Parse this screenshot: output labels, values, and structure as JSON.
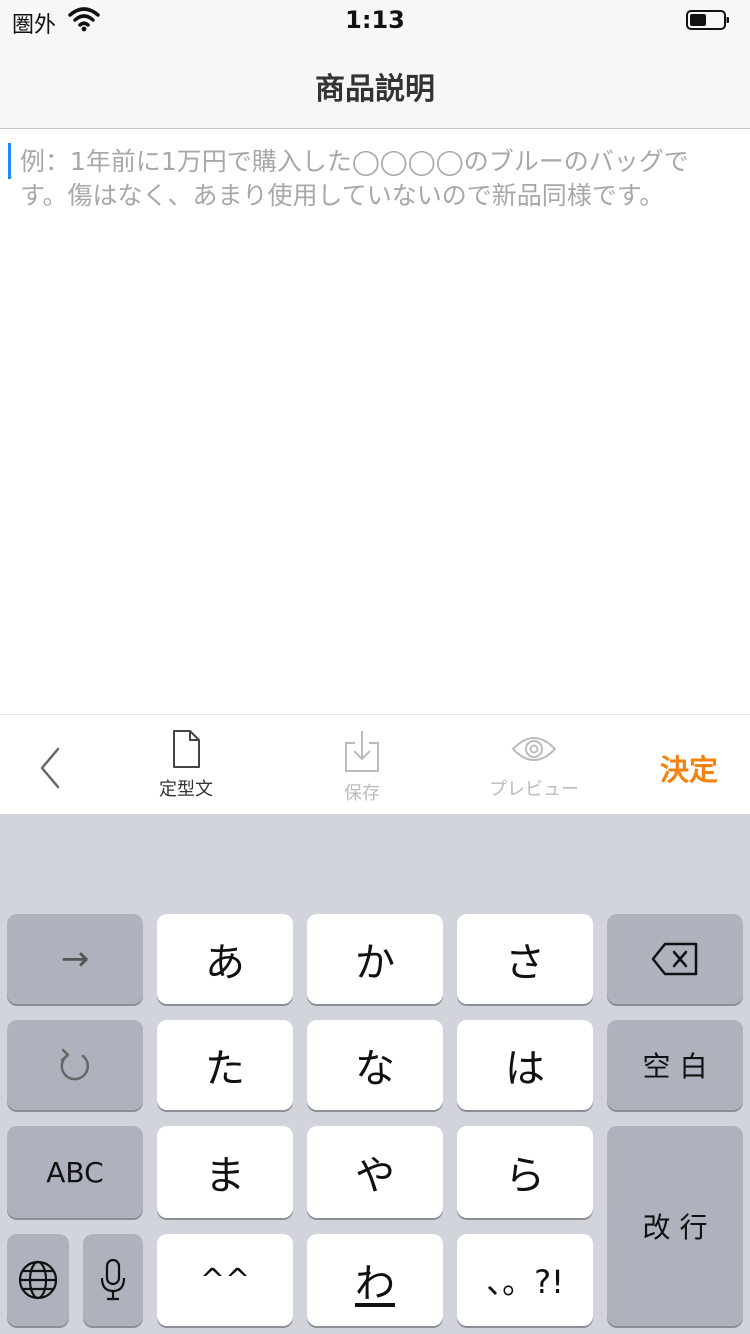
{
  "status_bar": {
    "carrier": "圏外",
    "time": "1:13",
    "wifi_icon": "wifi-icon",
    "battery_icon": "battery-icon"
  },
  "nav": {
    "title": "商品説明"
  },
  "editor": {
    "placeholder": "例：1年前に1万円で購入した◯◯◯◯のブルーのバッグです。傷はなく、あまり使用していないので新品同様です。",
    "accent": "#1d8ef0"
  },
  "toolbar": {
    "back_icon": "chevron-left-icon",
    "template_label": "定型文",
    "template_icon": "document-icon",
    "save_label": "保存",
    "save_icon": "download-icon",
    "preview_label": "プレビュー",
    "preview_icon": "eye-icon",
    "decide_label": "決定",
    "decide_color": "#f3830f"
  },
  "keyboard": {
    "arrow": "→",
    "backspace_icon": "backspace-icon",
    "undo_icon": "undo-icon",
    "space": "空 白",
    "abc": "ABC",
    "enter": "改 行",
    "globe_icon": "globe-icon",
    "mic_icon": "microphone-icon",
    "kana": [
      "あ",
      "か",
      "さ",
      "た",
      "な",
      "は",
      "ま",
      "や",
      "ら",
      "^^",
      "わ",
      "、。?!"
    ]
  }
}
